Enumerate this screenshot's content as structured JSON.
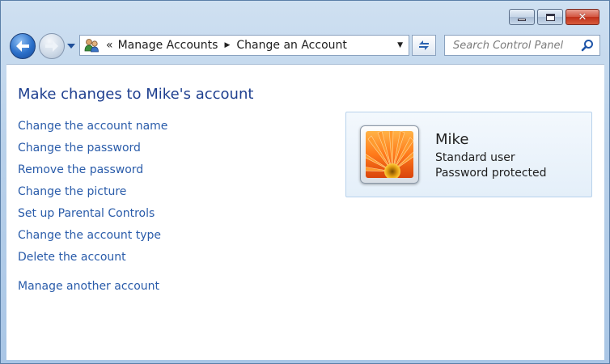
{
  "window": {
    "title_buttons": {
      "minimize": "minimize",
      "maximize": "maximize",
      "close": "close"
    }
  },
  "navigation": {
    "breadcrumb": {
      "overflow": "«",
      "items": [
        "Manage Accounts",
        "Change an Account"
      ]
    },
    "search_placeholder": "Search Control Panel"
  },
  "page": {
    "title": "Make changes to Mike's account",
    "tasks": [
      "Change the account name",
      "Change the password",
      "Remove the password",
      "Change the picture",
      "Set up Parental Controls",
      "Change the account type",
      "Delete the account"
    ],
    "other_task": "Manage another account"
  },
  "user_card": {
    "name": "Mike",
    "account_type": "Standard user",
    "password_status": "Password protected",
    "picture": "flower-icon"
  },
  "colors": {
    "link": "#2a5caa",
    "title": "#1e3f8f",
    "close_button": "#c0301a"
  }
}
